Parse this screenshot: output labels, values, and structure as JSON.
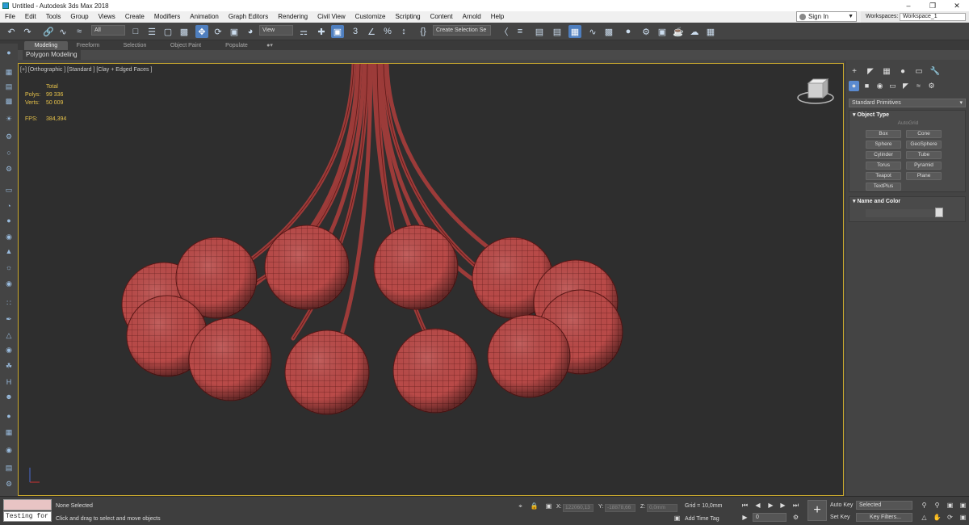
{
  "window": {
    "title": "Untitled - Autodesk 3ds Max 2018"
  },
  "menu": [
    "File",
    "Edit",
    "Tools",
    "Group",
    "Views",
    "Create",
    "Modifiers",
    "Animation",
    "Graph Editors",
    "Rendering",
    "Civil View",
    "Customize",
    "Scripting",
    "Content",
    "Arnold",
    "Help"
  ],
  "signin": {
    "label": "Sign In"
  },
  "workspaces": {
    "label": "Workspaces:",
    "value": "Workspace_1"
  },
  "toolbar": {
    "filter": "All",
    "refcoord": "View",
    "selection_set": "Create Selection Se"
  },
  "ribbon": {
    "tabs": [
      "Modeling",
      "Freeform",
      "Selection",
      "Object Paint",
      "Populate"
    ],
    "active": "Modeling",
    "sublabel": "Polygon Modeling"
  },
  "viewport": {
    "label": "[+] [Orthographic ] [Standard ] [Clay + Edged Faces ]",
    "stats": {
      "total_label": "Total",
      "polys_label": "Polys:",
      "polys": "99 336",
      "verts_label": "Verts:",
      "verts": "50 009",
      "fps_label": "FPS:",
      "fps": "384,394"
    },
    "colors": {
      "bg": "#2e2e2e",
      "sphere": "#b94a48",
      "border": "#c8a82e"
    }
  },
  "command_panel": {
    "dropdown": "Standard Primitives",
    "object_type": {
      "title": "Object Type",
      "autogrid": "AutoGrid",
      "buttons": [
        "Box",
        "Cone",
        "Sphere",
        "GeoSphere",
        "Cylinder",
        "Tube",
        "Torus",
        "Pyramid",
        "Teapot",
        "Plane",
        "TextPlus"
      ]
    },
    "name_color": {
      "title": "Name and Color"
    }
  },
  "status": {
    "maxscript": "Testing for :",
    "selected": "None Selected",
    "prompt": "Click and drag to select and move objects",
    "x_label": "X:",
    "x": "122060,13",
    "y_label": "Y:",
    "y": "-18878,66",
    "z_label": "Z:",
    "z": "0,0mm",
    "grid": "Grid = 10,0mm",
    "add_time_tag": "Add Time Tag",
    "frame": "0",
    "autokey": "Auto Key",
    "setkey": "Set Key",
    "key_dropdown": "Selected",
    "key_filters": "Key Filters..."
  }
}
